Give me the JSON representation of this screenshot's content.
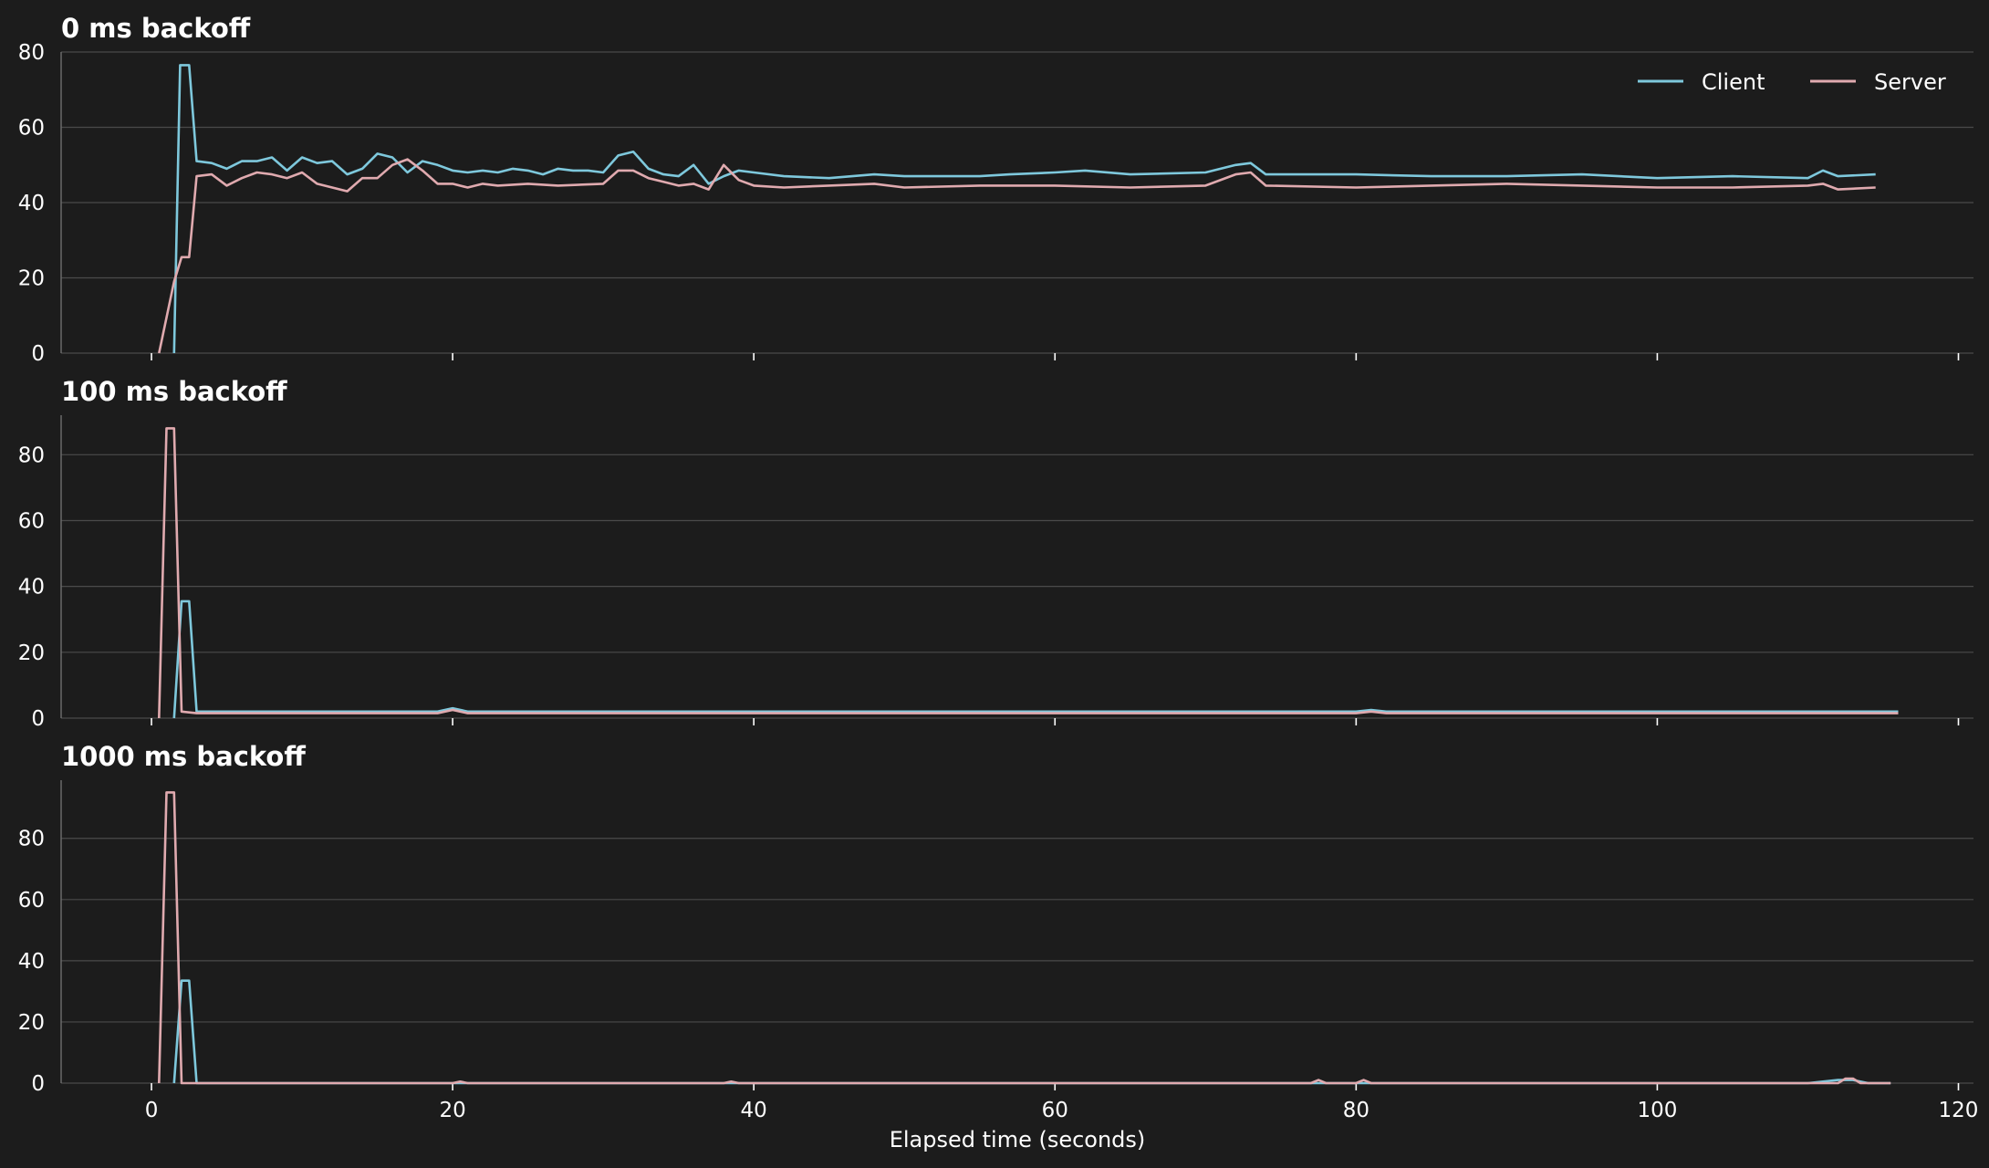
{
  "colors": {
    "background": "#1c1c1c",
    "client": "#7ec8dc",
    "server": "#e0aaaf"
  },
  "chart_data": [
    {
      "type": "line",
      "title": "0 ms backoff",
      "xlim": [
        -6,
        121
      ],
      "ylim": [
        0,
        80
      ],
      "yticks": [
        0,
        20,
        40,
        60,
        80
      ],
      "xticks": [
        0,
        20,
        40,
        60,
        80,
        100,
        120
      ],
      "grid": true,
      "legend": {
        "placement": "top-right"
      },
      "series": [
        {
          "name": "Client",
          "color": "#7ec8dc",
          "points": [
            [
              1.5,
              0
            ],
            [
              1.5,
              0
            ],
            [
              1.9,
              76.5
            ],
            [
              2.5,
              76.5
            ],
            [
              3,
              51
            ],
            [
              4,
              50.5
            ],
            [
              5,
              49
            ],
            [
              6,
              51
            ],
            [
              7,
              51
            ],
            [
              8,
              52
            ],
            [
              9,
              48.5
            ],
            [
              10,
              52
            ],
            [
              11,
              50.5
            ],
            [
              12,
              51
            ],
            [
              13,
              47.5
            ],
            [
              14,
              49
            ],
            [
              15,
              53
            ],
            [
              16,
              52
            ],
            [
              17,
              48
            ],
            [
              18,
              51
            ],
            [
              19,
              50
            ],
            [
              20,
              48.5
            ],
            [
              21,
              48
            ],
            [
              22,
              48.5
            ],
            [
              23,
              48
            ],
            [
              24,
              49
            ],
            [
              25,
              48.5
            ],
            [
              26,
              47.5
            ],
            [
              27,
              49
            ],
            [
              28,
              48.5
            ],
            [
              29,
              48.5
            ],
            [
              30,
              48
            ],
            [
              31,
              52.5
            ],
            [
              32,
              53.5
            ],
            [
              33,
              49
            ],
            [
              34,
              47.5
            ],
            [
              35,
              47
            ],
            [
              36,
              50
            ],
            [
              37,
              45
            ],
            [
              38,
              47
            ],
            [
              39,
              48.5
            ],
            [
              40,
              48
            ],
            [
              42,
              47
            ],
            [
              45,
              46.5
            ],
            [
              48,
              47.5
            ],
            [
              50,
              47
            ],
            [
              55,
              47
            ],
            [
              57,
              47.5
            ],
            [
              60,
              48
            ],
            [
              62,
              48.5
            ],
            [
              65,
              47.5
            ],
            [
              70,
              48
            ],
            [
              72,
              50
            ],
            [
              73,
              50.5
            ],
            [
              74,
              47.5
            ],
            [
              80,
              47.5
            ],
            [
              85,
              47
            ],
            [
              90,
              47
            ],
            [
              95,
              47.5
            ],
            [
              100,
              46.5
            ],
            [
              105,
              47
            ],
            [
              110,
              46.5
            ],
            [
              111,
              48.5
            ],
            [
              112,
              47
            ],
            [
              114.5,
              47.5
            ]
          ]
        },
        {
          "name": "Server",
          "color": "#e0aaaf",
          "points": [
            [
              0.5,
              0
            ],
            [
              1.5,
              19
            ],
            [
              2,
              25.5
            ],
            [
              2.5,
              25.5
            ],
            [
              3,
              47
            ],
            [
              4,
              47.5
            ],
            [
              5,
              44.5
            ],
            [
              6,
              46.5
            ],
            [
              7,
              48
            ],
            [
              8,
              47.5
            ],
            [
              9,
              46.5
            ],
            [
              10,
              48
            ],
            [
              11,
              45
            ],
            [
              12,
              44
            ],
            [
              13,
              43
            ],
            [
              14,
              46.5
            ],
            [
              15,
              46.5
            ],
            [
              16,
              50
            ],
            [
              17,
              51.5
            ],
            [
              18,
              48.5
            ],
            [
              19,
              45
            ],
            [
              20,
              45
            ],
            [
              21,
              44
            ],
            [
              22,
              45
            ],
            [
              23,
              44.5
            ],
            [
              25,
              45
            ],
            [
              27,
              44.5
            ],
            [
              30,
              45
            ],
            [
              31,
              48.5
            ],
            [
              32,
              48.5
            ],
            [
              33,
              46.5
            ],
            [
              34,
              45.5
            ],
            [
              35,
              44.5
            ],
            [
              36,
              45
            ],
            [
              37,
              43.5
            ],
            [
              38,
              50
            ],
            [
              39,
              46
            ],
            [
              40,
              44.5
            ],
            [
              42,
              44
            ],
            [
              45,
              44.5
            ],
            [
              48,
              45
            ],
            [
              50,
              44
            ],
            [
              55,
              44.5
            ],
            [
              60,
              44.5
            ],
            [
              65,
              44
            ],
            [
              70,
              44.5
            ],
            [
              72,
              47.5
            ],
            [
              73,
              48
            ],
            [
              74,
              44.5
            ],
            [
              80,
              44
            ],
            [
              85,
              44.5
            ],
            [
              90,
              45
            ],
            [
              95,
              44.5
            ],
            [
              100,
              44
            ],
            [
              105,
              44
            ],
            [
              110,
              44.5
            ],
            [
              111,
              45
            ],
            [
              112,
              43.5
            ],
            [
              114.5,
              44
            ]
          ]
        }
      ]
    },
    {
      "type": "line",
      "title": "100 ms backoff",
      "xlim": [
        -6,
        121
      ],
      "ylim": [
        0,
        92
      ],
      "yticks": [
        0,
        20,
        40,
        60,
        80
      ],
      "xticks": [
        0,
        20,
        40,
        60,
        80,
        100,
        120
      ],
      "grid": true,
      "series": [
        {
          "name": "Client",
          "color": "#7ec8dc",
          "points": [
            [
              1.5,
              0
            ],
            [
              1.5,
              0
            ],
            [
              2,
              35.5
            ],
            [
              2.5,
              35.5
            ],
            [
              3,
              2
            ],
            [
              5,
              2
            ],
            [
              10,
              2
            ],
            [
              15,
              2
            ],
            [
              19,
              2
            ],
            [
              20,
              3
            ],
            [
              21,
              2
            ],
            [
              25,
              2
            ],
            [
              30,
              2
            ],
            [
              35,
              2
            ],
            [
              40,
              2
            ],
            [
              50,
              2
            ],
            [
              60,
              2
            ],
            [
              70,
              2
            ],
            [
              80,
              2
            ],
            [
              81,
              2.5
            ],
            [
              82,
              2
            ],
            [
              90,
              2
            ],
            [
              100,
              2
            ],
            [
              110,
              2
            ],
            [
              116,
              2
            ]
          ]
        },
        {
          "name": "Server",
          "color": "#e0aaaf",
          "points": [
            [
              0.5,
              0
            ],
            [
              0.5,
              0
            ],
            [
              1,
              88
            ],
            [
              1.5,
              88
            ],
            [
              2,
              2
            ],
            [
              3,
              1.5
            ],
            [
              5,
              1.5
            ],
            [
              10,
              1.5
            ],
            [
              15,
              1.5
            ],
            [
              19,
              1.5
            ],
            [
              20,
              2.5
            ],
            [
              21,
              1.5
            ],
            [
              30,
              1.5
            ],
            [
              40,
              1.5
            ],
            [
              50,
              1.5
            ],
            [
              60,
              1.5
            ],
            [
              70,
              1.5
            ],
            [
              80,
              1.5
            ],
            [
              81,
              2
            ],
            [
              82,
              1.5
            ],
            [
              90,
              1.5
            ],
            [
              100,
              1.5
            ],
            [
              110,
              1.5
            ],
            [
              116,
              1.5
            ]
          ]
        }
      ]
    },
    {
      "type": "line",
      "title": "1000 ms backoff",
      "xlim": [
        -6,
        121
      ],
      "ylim": [
        0,
        99
      ],
      "yticks": [
        0,
        20,
        40,
        60,
        80
      ],
      "xticks": [
        0,
        20,
        40,
        60,
        80,
        100,
        120
      ],
      "xticklabels": [
        "0",
        "20",
        "40",
        "60",
        "80",
        "100",
        "120"
      ],
      "xlabel": "Elapsed time (seconds)",
      "grid": true,
      "series": [
        {
          "name": "Client",
          "color": "#7ec8dc",
          "points": [
            [
              1.5,
              0
            ],
            [
              1.5,
              0
            ],
            [
              2,
              33.5
            ],
            [
              2.5,
              33.5
            ],
            [
              3,
              0
            ],
            [
              10,
              0
            ],
            [
              20,
              0
            ],
            [
              40,
              0
            ],
            [
              60,
              0
            ],
            [
              80,
              0
            ],
            [
              100,
              0
            ],
            [
              110,
              0
            ],
            [
              112,
              1
            ],
            [
              113,
              1
            ],
            [
              114,
              0
            ],
            [
              115.5,
              0
            ]
          ]
        },
        {
          "name": "Server",
          "color": "#e0aaaf",
          "points": [
            [
              0.5,
              0
            ],
            [
              0.5,
              0
            ],
            [
              1,
              95
            ],
            [
              1.5,
              95
            ],
            [
              2,
              0
            ],
            [
              10,
              0
            ],
            [
              20,
              0
            ],
            [
              20.5,
              0.5
            ],
            [
              21,
              0
            ],
            [
              38,
              0
            ],
            [
              38.5,
              0.5
            ],
            [
              39,
              0
            ],
            [
              66,
              0
            ],
            [
              77,
              0
            ],
            [
              77.5,
              1
            ],
            [
              78,
              0
            ],
            [
              80,
              0
            ],
            [
              80.5,
              1
            ],
            [
              81,
              0
            ],
            [
              100,
              0
            ],
            [
              112,
              0
            ],
            [
              112.5,
              1.5
            ],
            [
              113,
              1.5
            ],
            [
              113.5,
              0
            ],
            [
              115.5,
              0
            ]
          ]
        }
      ]
    }
  ]
}
